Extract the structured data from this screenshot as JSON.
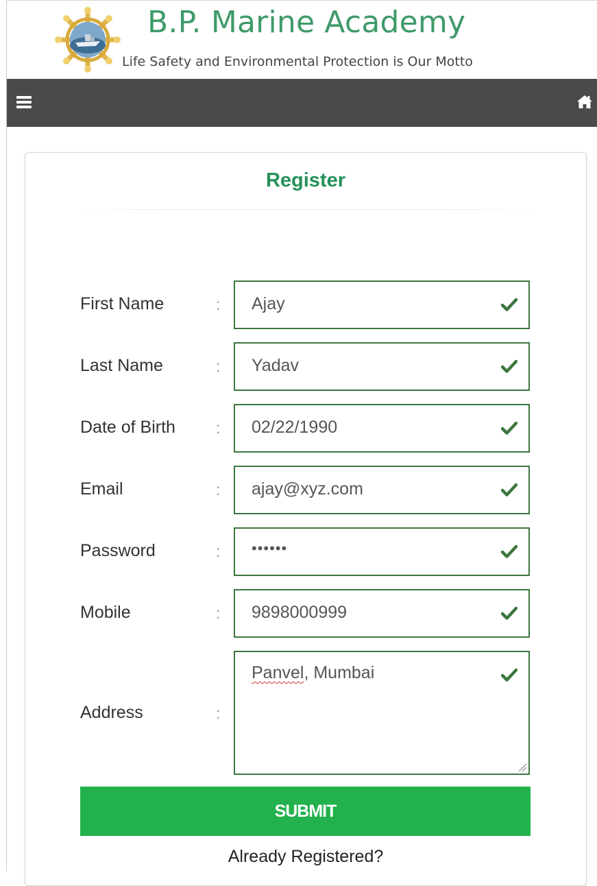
{
  "header": {
    "title": "B.P. Marine Academy",
    "tagline": "Life Safety and Environmental Protection is Our Motto",
    "title_color": "#3f9a6a"
  },
  "navbar": {
    "background": "#4a4a4a",
    "left_icon": "hamburger-menu-icon",
    "right_icon": "home-icon"
  },
  "form": {
    "title": "Register",
    "title_color": "#24915a",
    "valid_color": "#3c763d",
    "fields": [
      {
        "label": "First Name",
        "value": "Ajay",
        "valid": true
      },
      {
        "label": "Last Name",
        "value": "Yadav",
        "valid": true
      },
      {
        "label": "Date of Birth",
        "value": "02/22/1990",
        "valid": true
      },
      {
        "label": "Email",
        "value": "ajay@xyz.com",
        "valid": true
      },
      {
        "label": "Password",
        "value": "••••••",
        "valid": true
      },
      {
        "label": "Mobile",
        "value": "9898000999",
        "valid": true
      },
      {
        "label": "Address",
        "value_part1": "Panvel",
        "value_part2": ", Mumbai",
        "valid": true
      }
    ],
    "colon": ":",
    "submit_label": "SUBMIT",
    "submit_color": "#22b14c",
    "already_registered": "Already Registered?"
  }
}
